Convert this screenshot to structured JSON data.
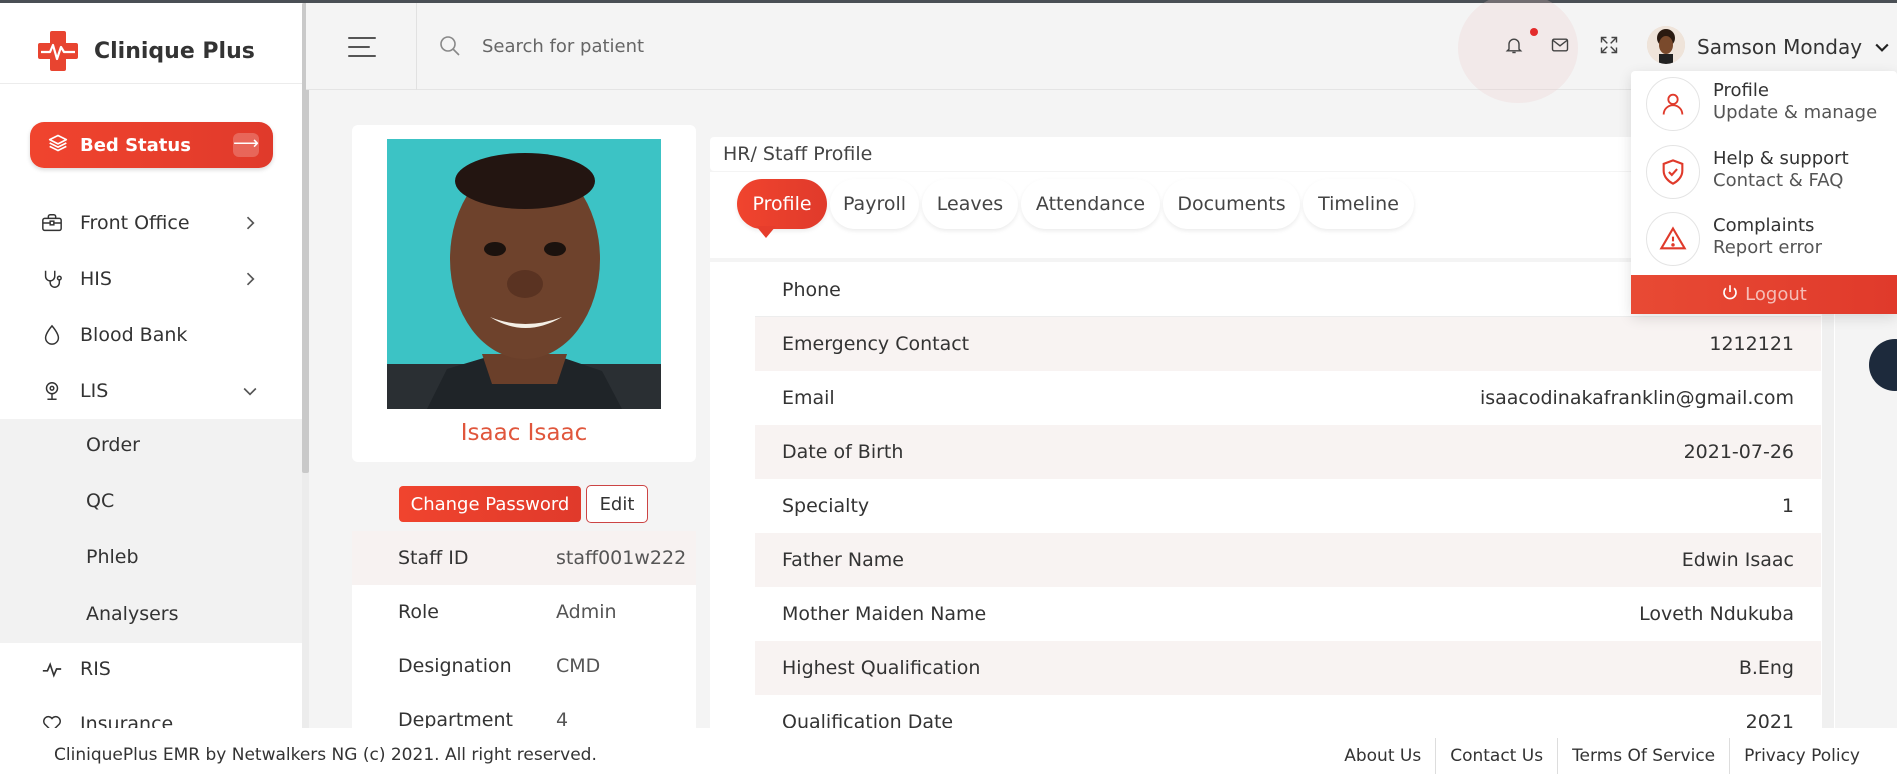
{
  "app": {
    "name": "Clinique Plus",
    "brand_color": "#e84430"
  },
  "sidebar": {
    "bed_status_label": "Bed Status",
    "bed_status_arrow": "⟶",
    "items": [
      {
        "label": "Front Office",
        "icon": "briefcase-icon",
        "has_chevron": true
      },
      {
        "label": "HIS",
        "icon": "stethoscope-icon",
        "has_chevron": true
      },
      {
        "label": "Blood Bank",
        "icon": "droplet-icon",
        "has_chevron": false
      },
      {
        "label": "LIS",
        "icon": "microscope-icon",
        "has_chevron": true,
        "expanded": true
      },
      {
        "label": "RIS",
        "icon": "activity-icon",
        "has_chevron": false
      },
      {
        "label": "Insurance",
        "icon": "heart-icon",
        "has_chevron": false
      }
    ],
    "lis_subitems": [
      "Order",
      "QC",
      "Phleb",
      "Analysers"
    ]
  },
  "header": {
    "search_placeholder": "Search for patient",
    "user_name": "Samson Monday"
  },
  "profile": {
    "name": "Isaac Isaac",
    "change_password_label": "Change Password",
    "edit_label": "Edit",
    "info": [
      {
        "label": "Staff ID",
        "value": "staff001w222"
      },
      {
        "label": "Role",
        "value": "Admin"
      },
      {
        "label": "Designation",
        "value": "CMD"
      },
      {
        "label": "Department",
        "value": "4"
      }
    ]
  },
  "main": {
    "breadcrumb": "HR/ Staff Profile",
    "tabs": [
      "Profile",
      "Payroll",
      "Leaves",
      "Attendance",
      "Documents",
      "Timeline"
    ],
    "active_tab": "Profile",
    "details": [
      {
        "label": "Phone",
        "value": ""
      },
      {
        "label": "Emergency Contact",
        "value": "1212121"
      },
      {
        "label": "Email",
        "value": "isaacodinakafranklin@gmail.com"
      },
      {
        "label": "Date of Birth",
        "value": "2021-07-26"
      },
      {
        "label": "Specialty",
        "value": "1"
      },
      {
        "label": "Father Name",
        "value": "Edwin Isaac"
      },
      {
        "label": "Mother Maiden Name",
        "value": "Loveth Ndukuba"
      },
      {
        "label": "Highest Qualification",
        "value": "B.Eng"
      },
      {
        "label": "Qualification Date",
        "value": "2021"
      }
    ]
  },
  "user_menu": {
    "items": [
      {
        "title": "Profile",
        "subtitle": "Update & manage",
        "icon": "user-icon"
      },
      {
        "title": "Help & support",
        "subtitle": "Contact & FAQ",
        "icon": "shield-icon"
      },
      {
        "title": "Complaints",
        "subtitle": "Report error",
        "icon": "warning-icon"
      }
    ],
    "logout_label": "Logout"
  },
  "footer": {
    "copyright": "CliniquePlus EMR by Netwalkers NG (c) 2021. All right reserved.",
    "links": [
      "About Us",
      "Contact Us",
      "Terms Of Service",
      "Privacy Policy"
    ]
  }
}
